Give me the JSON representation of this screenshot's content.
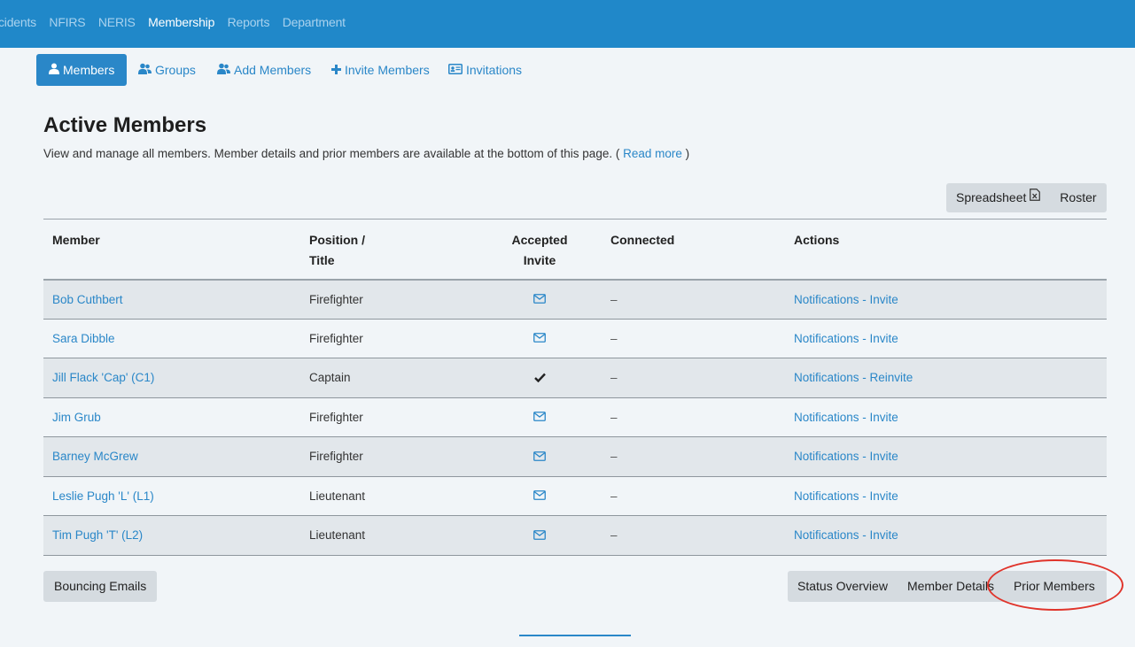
{
  "topnav": {
    "items": [
      "cidents",
      "NFIRS",
      "NERIS",
      "Membership",
      "Reports",
      "Department"
    ],
    "active_index": 3
  },
  "subnav": {
    "members": "Members",
    "groups": "Groups",
    "add_members": "Add Members",
    "invite_members": "Invite Members",
    "invitations": "Invitations"
  },
  "page": {
    "title": "Active Members",
    "intro": "View and manage all members. Member details and prior members are available at the bottom of this page. (",
    "read_more": "Read more",
    "intro_close": ")"
  },
  "export": {
    "spreadsheet": "Spreadsheet",
    "roster": "Roster"
  },
  "table": {
    "headers": {
      "member": "Member",
      "position_line1": "Position /",
      "position_line2": "Title",
      "accepted_line1": "Accepted",
      "accepted_line2": "Invite",
      "connected": "Connected",
      "actions": "Actions"
    },
    "rows": [
      {
        "name": "Bob Cuthbert",
        "position": "Firefighter",
        "accepted": "envelope",
        "connected": "–",
        "actions": "Notifications - Invite"
      },
      {
        "name": "Sara Dibble",
        "position": "Firefighter",
        "accepted": "envelope",
        "connected": "–",
        "actions": "Notifications - Invite"
      },
      {
        "name": "Jill Flack 'Cap' (C1)",
        "position": "Captain",
        "accepted": "check",
        "connected": "–",
        "actions": "Notifications - Reinvite"
      },
      {
        "name": "Jim Grub",
        "position": "Firefighter",
        "accepted": "envelope",
        "connected": "–",
        "actions": "Notifications - Invite"
      },
      {
        "name": "Barney McGrew",
        "position": "Firefighter",
        "accepted": "envelope",
        "connected": "–",
        "actions": "Notifications - Invite"
      },
      {
        "name": "Leslie Pugh 'L' (L1)",
        "position": "Lieutenant",
        "accepted": "envelope",
        "connected": "–",
        "actions": "Notifications - Invite"
      },
      {
        "name": "Tim Pugh 'T' (L2)",
        "position": "Lieutenant",
        "accepted": "envelope",
        "connected": "–",
        "actions": "Notifications - Invite"
      }
    ]
  },
  "footer": {
    "bouncing_emails": "Bouncing Emails",
    "status_overview": "Status Overview",
    "member_details": "Member Details",
    "prior_members": "Prior Members"
  },
  "colors": {
    "topbar": "#2088c9",
    "accent": "#2a87c8",
    "annotation": "#e0342b"
  }
}
